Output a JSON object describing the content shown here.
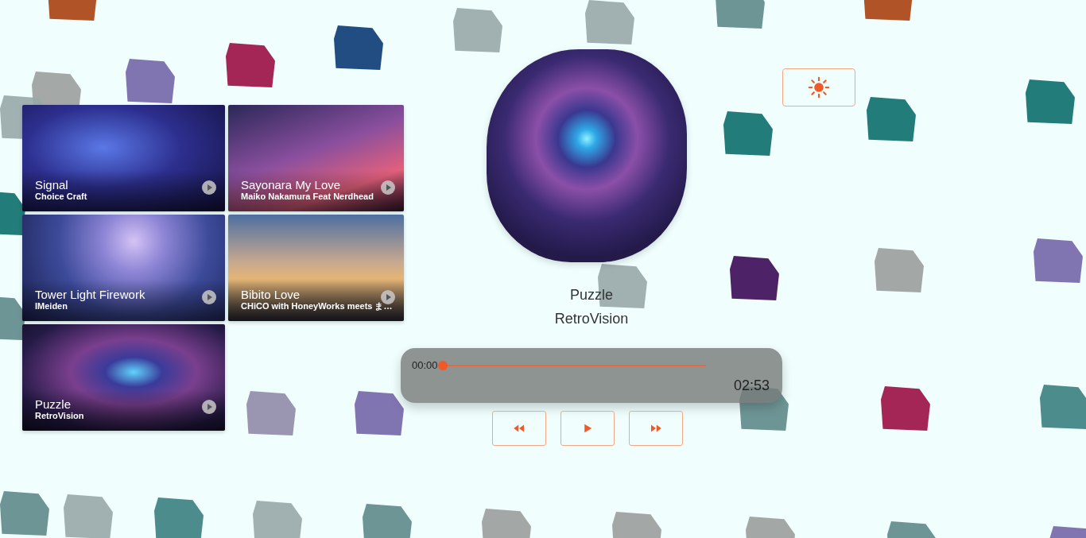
{
  "playlist": [
    {
      "title": "Signal",
      "artist": "Choice Craft"
    },
    {
      "title": "Sayonara My Love",
      "artist": "Maiko Nakamura Feat Nerdhead"
    },
    {
      "title": "Tower Light Firework",
      "artist": "IMeiden"
    },
    {
      "title": "Bibito Love",
      "artist": "CHiCO with HoneyWorks meets ま…"
    },
    {
      "title": "Puzzle",
      "artist": "RetroVision"
    }
  ],
  "now_playing": {
    "title": "Puzzle",
    "artist": "RetroVision",
    "playing": false
  },
  "progress": {
    "elapsed": "00:00",
    "total": "02:53",
    "level": 0
  }
}
